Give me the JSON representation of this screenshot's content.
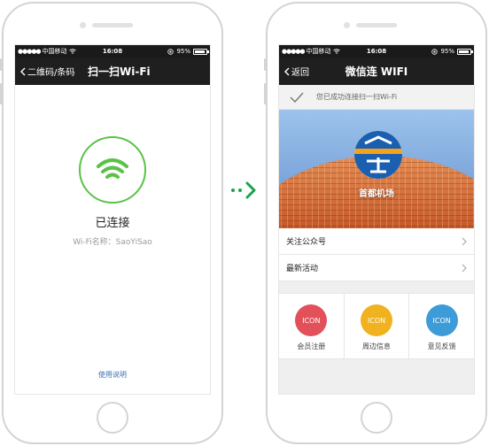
{
  "statusbar": {
    "carrier": "中国移动",
    "time": "16:08",
    "battery": "95%",
    "battery_level": 0.95
  },
  "left_phone": {
    "nav": {
      "back_label": "二维码/条码",
      "title": "扫一扫Wi-Fi"
    },
    "status_text": "已连接",
    "ssid_text": "Wi-Fi名称：SaoYiSao",
    "usage_link": "使用说明"
  },
  "right_phone": {
    "nav": {
      "back_label": "返回",
      "title": "微信连 WIFI"
    },
    "success_text": "您已成功连接扫一扫Wi-Fi",
    "banner": {
      "brand_name": "首都机场"
    },
    "list": [
      {
        "label": "关注公众号"
      },
      {
        "label": "最新活动"
      }
    ],
    "grid": [
      {
        "icon_text": "ICON",
        "label": "会员注册",
        "color": "#e2515a"
      },
      {
        "icon_text": "ICON",
        "label": "周边信息",
        "color": "#f0b21f"
      },
      {
        "icon_text": "ICON",
        "label": "意见反馈",
        "color": "#3d9bd8"
      }
    ]
  },
  "colors": {
    "accent_green": "#5ac247",
    "arrow_green": "#1aa34a",
    "nav_bg": "#1f1f1f"
  }
}
